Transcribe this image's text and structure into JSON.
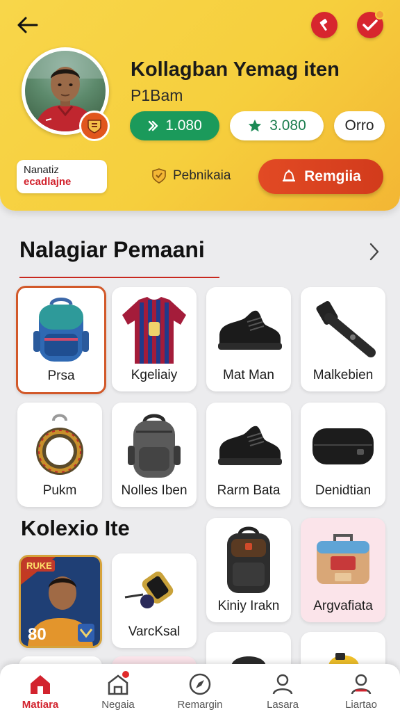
{
  "profile": {
    "name": "Kollagban Yemag iten",
    "subtitle": "P1Bam",
    "coins_value": "1.080",
    "stars_value": "3.080",
    "more_label": "Orro",
    "tag_line1": "Nanatiz",
    "tag_line2": "ecadlajne",
    "verified_label": "Pebnikaia",
    "claim_label": "Remgiia"
  },
  "colors": {
    "header_yellow": "#f6cf3d",
    "accent_red": "#d2232e",
    "coin_green": "#1b9a5b",
    "claim_orange": "#e24a24"
  },
  "section1": {
    "title": "Nalagiar Pemaani",
    "items": [
      {
        "label": "Prsa",
        "icon": "backpack-icon",
        "selected": true
      },
      {
        "label": "Kgeliaiy",
        "icon": "jersey-icon"
      },
      {
        "label": "Mat Man",
        "icon": "shoe-icon"
      },
      {
        "label": "Malkebien",
        "icon": "strap-icon"
      },
      {
        "label": "Pukm",
        "icon": "ring-icon"
      },
      {
        "label": "Nolles Iben",
        "icon": "backpack-icon"
      },
      {
        "label": "Rarm Bata",
        "icon": "shoe-icon"
      },
      {
        "label": "Denidtian",
        "icon": "case-icon"
      }
    ]
  },
  "section2": {
    "title": "Kolexio Ite",
    "player_card_badge": "RUKE",
    "player_card_rating": "80",
    "items": [
      {
        "label": "VarcKsal",
        "icon": "dumbbell-icon"
      },
      {
        "label": "Kiniy Irakn",
        "icon": "rucksack-icon"
      },
      {
        "label": "Argvafiata",
        "icon": "suitcase-icon"
      }
    ]
  },
  "nav": [
    {
      "label": "Matiara",
      "icon": "home-icon",
      "active": true
    },
    {
      "label": "Negaia",
      "icon": "store-icon",
      "badge": true
    },
    {
      "label": "Remargin",
      "icon": "compass-icon"
    },
    {
      "label": "Lasara",
      "icon": "user-icon"
    },
    {
      "label": "Liartao",
      "icon": "profile-icon"
    }
  ]
}
